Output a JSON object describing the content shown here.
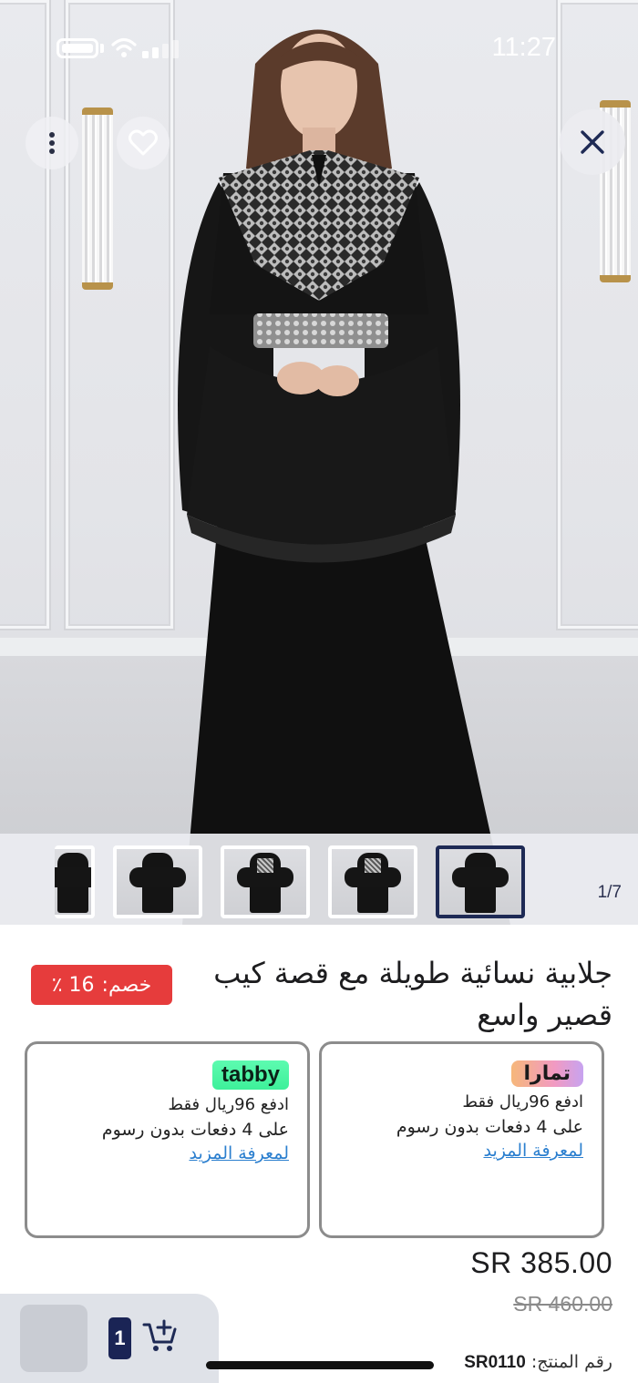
{
  "status_bar": {
    "time": "11:27"
  },
  "gallery": {
    "counter": "1/7"
  },
  "product": {
    "title": "جلابية نسائية طويلة مع قصة كيب قصير واسع",
    "discount_label": "خصم:",
    "discount_value": "16 ٪",
    "price": "SR 385.00",
    "old_price": "SR 460.00",
    "sku_label": "رقم المنتج:",
    "sku_value": "SR0110"
  },
  "tamara": {
    "logo": "تمارا",
    "line1": "ادفع 96ريال فقط",
    "line2": "على 4 دفعات بدون رسوم",
    "link": "لمعرفة المزيد"
  },
  "tabby": {
    "logo": "tabby",
    "line1": "ادفع 96ريال فقط",
    "line2": "على 4 دفعات بدون رسوم",
    "link": "لمعرفة المزيد"
  },
  "cart": {
    "quantity": "1"
  },
  "icons": {
    "more": "more-vertical-icon",
    "favorite": "heart-icon",
    "close": "close-icon",
    "add_to_cart": "cart-plus-icon"
  }
}
